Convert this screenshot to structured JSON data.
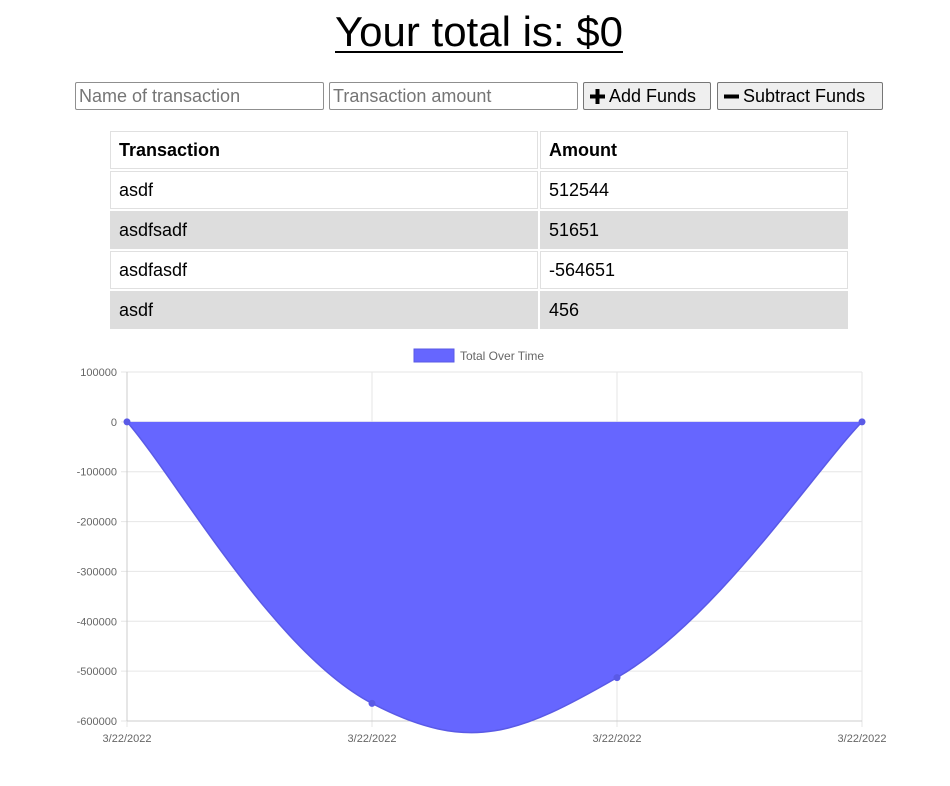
{
  "header": {
    "total_label": "Your total is: $0"
  },
  "form": {
    "name_placeholder": "Name of transaction",
    "amount_placeholder": "Transaction amount",
    "add_label": "Add Funds",
    "subtract_label": "Subtract Funds"
  },
  "table": {
    "headers": [
      "Transaction",
      "Amount"
    ],
    "rows": [
      {
        "name": "asdf",
        "amount": "512544"
      },
      {
        "name": "asdfsadf",
        "amount": "51651"
      },
      {
        "name": "asdfasdf",
        "amount": "-564651"
      },
      {
        "name": "asdf",
        "amount": "456"
      }
    ]
  },
  "chart_data": {
    "type": "area",
    "title": "",
    "xlabel": "",
    "ylabel": "",
    "legend": "top",
    "grid": true,
    "categories": [
      "3/22/2022",
      "3/22/2022",
      "3/22/2022",
      "3/22/2022"
    ],
    "series": [
      {
        "name": "Total Over Time",
        "values": [
          0,
          -564651,
          -513000,
          0
        ],
        "color": "#6666ff"
      }
    ],
    "ylim": [
      -600000,
      100000
    ],
    "yticks": [
      100000,
      0,
      -100000,
      -200000,
      -300000,
      -400000,
      -500000,
      -600000
    ]
  }
}
